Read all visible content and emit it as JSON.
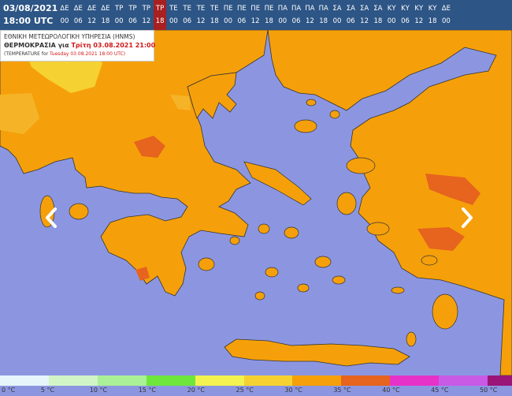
{
  "header": {
    "date": "03/08/2021",
    "time": "18:00 UTC",
    "timeline": [
      {
        "day": "ΔΕ",
        "hour": "00"
      },
      {
        "day": "ΔΕ",
        "hour": "06"
      },
      {
        "day": "ΔΕ",
        "hour": "12"
      },
      {
        "day": "ΔΕ",
        "hour": "18"
      },
      {
        "day": "ΤΡ",
        "hour": "00"
      },
      {
        "day": "ΤΡ",
        "hour": "06"
      },
      {
        "day": "ΤΡ",
        "hour": "12"
      },
      {
        "day": "ΤΡ",
        "hour": "18",
        "selected": true
      },
      {
        "day": "ΤΕ",
        "hour": "00"
      },
      {
        "day": "ΤΕ",
        "hour": "06"
      },
      {
        "day": "ΤΕ",
        "hour": "12"
      },
      {
        "day": "ΤΕ",
        "hour": "18"
      },
      {
        "day": "ΠΕ",
        "hour": "00"
      },
      {
        "day": "ΠΕ",
        "hour": "06"
      },
      {
        "day": "ΠΕ",
        "hour": "12"
      },
      {
        "day": "ΠΕ",
        "hour": "18"
      },
      {
        "day": "ΠΑ",
        "hour": "00"
      },
      {
        "day": "ΠΑ",
        "hour": "06"
      },
      {
        "day": "ΠΑ",
        "hour": "12"
      },
      {
        "day": "ΠΑ",
        "hour": "18"
      },
      {
        "day": "ΣΑ",
        "hour": "00"
      },
      {
        "day": "ΣΑ",
        "hour": "06"
      },
      {
        "day": "ΣΑ",
        "hour": "12"
      },
      {
        "day": "ΣΑ",
        "hour": "18"
      },
      {
        "day": "ΚΥ",
        "hour": "00"
      },
      {
        "day": "ΚΥ",
        "hour": "06"
      },
      {
        "day": "ΚΥ",
        "hour": "12"
      },
      {
        "day": "ΚΥ",
        "hour": "18"
      },
      {
        "day": "ΔΕ",
        "hour": "00"
      }
    ]
  },
  "info": {
    "agency": "ΕΘΝΙΚΗ ΜΕΤΕΩΡΟΛΟΓΙΚΗ ΥΠΗΡΕΣΙΑ (HNMS)",
    "param": "ΘΕΡΜΟΚΡΑΣΙΑ",
    "for_word": "για",
    "valid": "Τρίτη 03.08.2021 21:00",
    "en_prefix": "(TEMPERATURE for",
    "en_date": "Tuesday 03.08.2021 18:00 UTC)"
  },
  "nav": {
    "prev_icon": "chevron-left-icon",
    "next_icon": "chevron-right-icon"
  },
  "legend": [
    {
      "label": "0 °C",
      "color": "#e6f5fa"
    },
    {
      "label": "5 °C",
      "color": "#d2f5c8"
    },
    {
      "label": "10 °C",
      "color": "#aaf096"
    },
    {
      "label": "15 °C",
      "color": "#6ee63c"
    },
    {
      "label": "20 °C",
      "color": "#f2f250"
    },
    {
      "label": "25 °C",
      "color": "#f5d232"
    },
    {
      "label": "30 °C",
      "color": "#f5a00a"
    },
    {
      "label": "35 °C",
      "color": "#e6641e"
    },
    {
      "label": "40 °C",
      "color": "#e632c8"
    },
    {
      "label": "45 °C",
      "color": "#c85ae6"
    },
    {
      "label": "50 °C",
      "color": "#9b1478"
    }
  ],
  "colors": {
    "sea": "#8c96e0",
    "land_main": "#f5a00a",
    "land_light": "#f5b428",
    "land_hot": "#e6641e",
    "land_cool": "#f2f250",
    "header_bg": "#2d5585",
    "selected": "#a82020"
  }
}
